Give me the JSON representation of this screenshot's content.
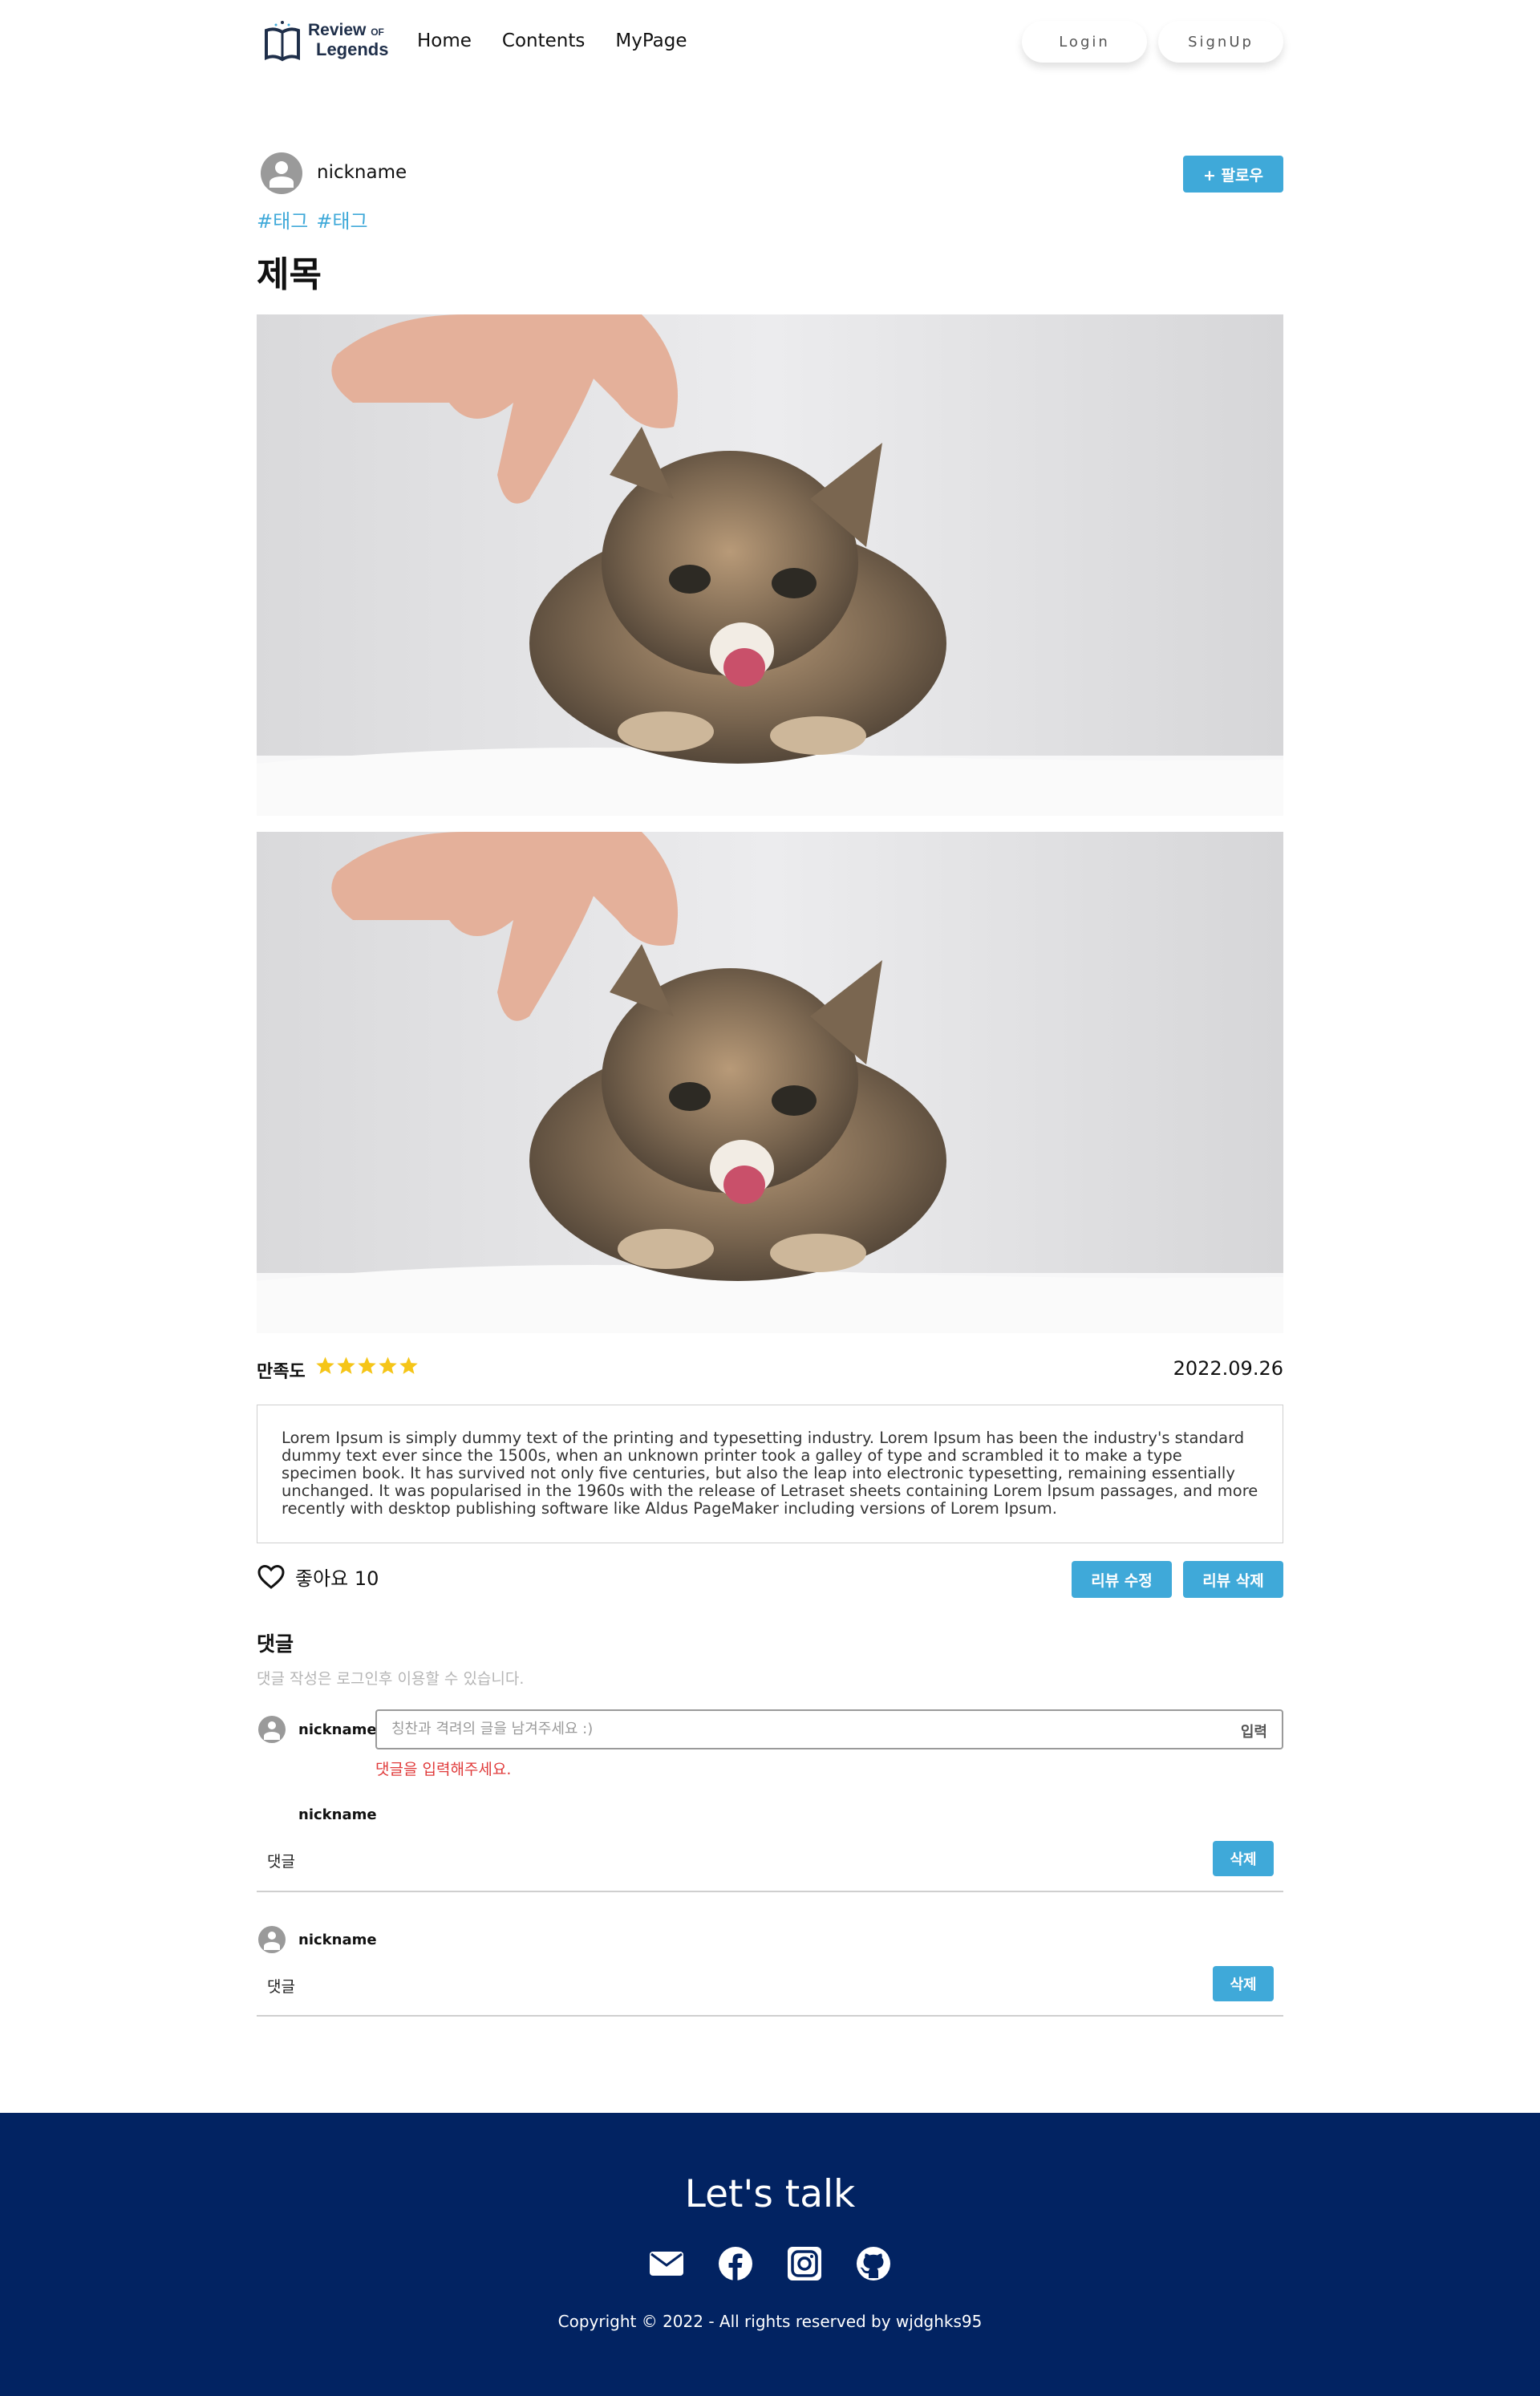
{
  "header": {
    "logo_line1": "Review",
    "logo_of": "OF",
    "logo_line2": "Legends",
    "nav": [
      "Home",
      "Contents",
      "MyPage"
    ],
    "login_label": "Login",
    "signup_label": "SignUp"
  },
  "post": {
    "author": "nickname",
    "follow_label": "+ 팔로우",
    "tags": [
      "#태그",
      "#태그"
    ],
    "title": "제목",
    "rating_label": "만족도",
    "rating": 5,
    "rating_max": 5,
    "date": "2022.09.26",
    "body": "Lorem Ipsum is simply dummy text of the printing and typesetting industry. Lorem Ipsum has been the industry's standard dummy text ever since the 1500s, when an unknown printer took a galley of type and scrambled it to make a type specimen book. It has survived not only five centuries, but also the leap into electronic typesetting, remaining essentially unchanged. It was popularised in the 1960s with the release of Letraset sheets containing Lorem Ipsum passages, and more recently with desktop publishing software like Aldus PageMaker including versions of Lorem Ipsum.",
    "like_label": "좋아요 10",
    "edit_label": "리뷰 수정",
    "delete_label": "리뷰 삭제"
  },
  "comments": {
    "heading": "댓글",
    "notice": "댓글 작성은 로그인후 이용할 수 있습니다.",
    "input_user": "nickname",
    "input_placeholder": "칭찬과 격려의 글을 남겨주세요 :)",
    "submit_label": "입력",
    "error": "댓글을 입력해주세요.",
    "items": [
      {
        "user": "nickname",
        "text": "댓글",
        "delete_label": "삭제"
      },
      {
        "user": "nickname",
        "text": "댓글",
        "delete_label": "삭제"
      }
    ]
  },
  "footer": {
    "title": "Let's talk",
    "social_icons": [
      "mail-icon",
      "facebook-icon",
      "instagram-icon",
      "github-icon"
    ],
    "copyright": "Copyright © 2022 - All rights reserved by wjdghks95"
  },
  "colors": {
    "accent": "#3fa9d9",
    "footer_bg": "#022362",
    "star": "#f5c518",
    "error": "#e03a3a"
  }
}
